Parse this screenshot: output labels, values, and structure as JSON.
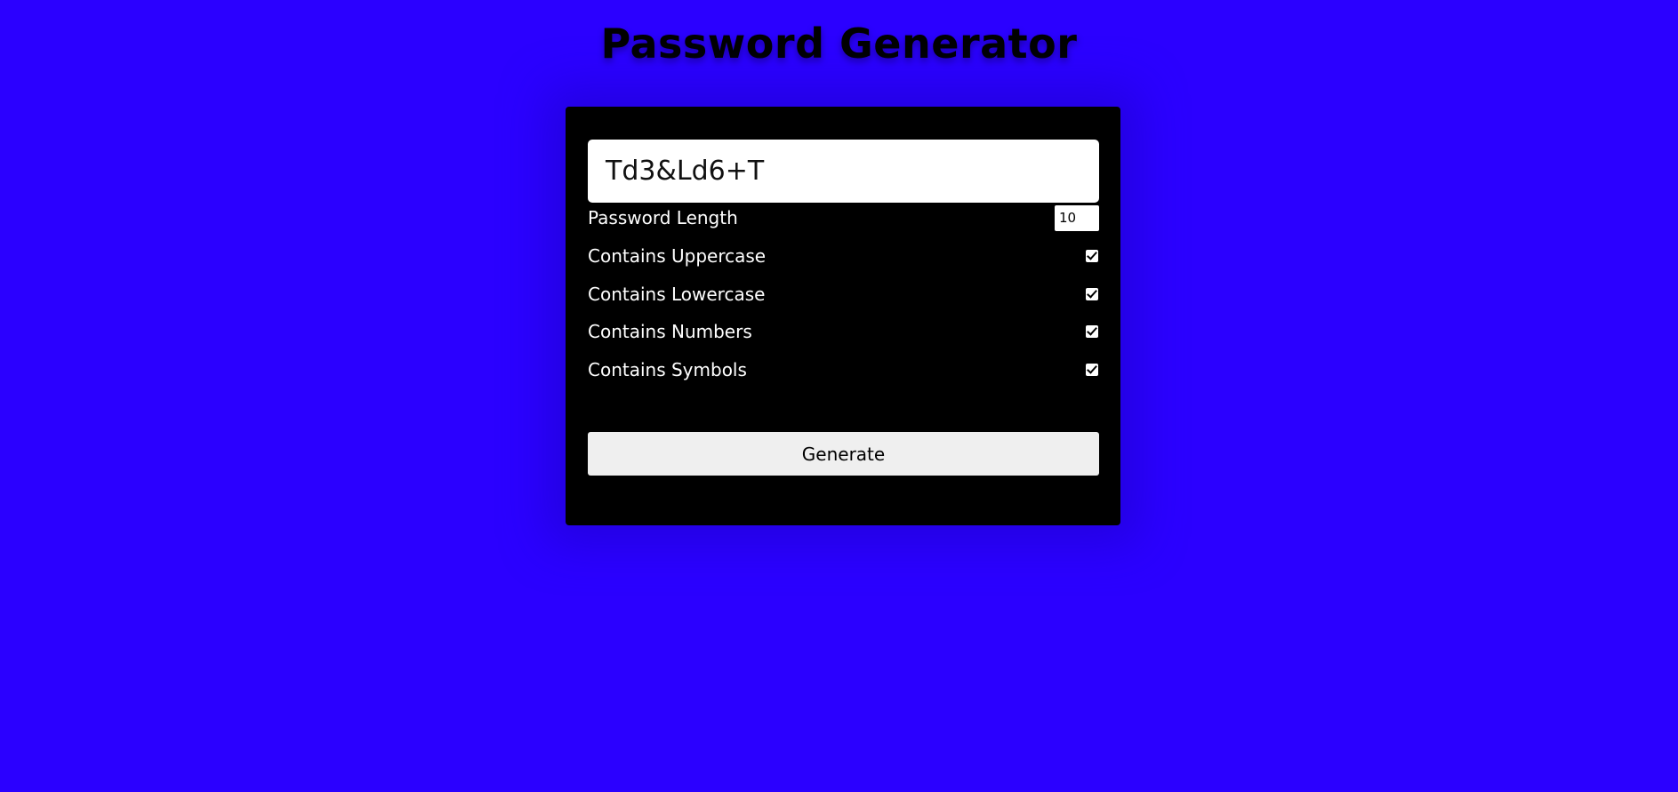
{
  "page": {
    "title": "Password Generator"
  },
  "result": {
    "value": "Td3&Ld6+T"
  },
  "settings": {
    "length_label": "Password Length",
    "length_value": "10",
    "options": [
      {
        "label": "Contains Uppercase",
        "checked": true
      },
      {
        "label": "Contains Lowercase",
        "checked": true
      },
      {
        "label": "Contains Numbers",
        "checked": true
      },
      {
        "label": "Contains Symbols",
        "checked": true
      }
    ]
  },
  "actions": {
    "generate_label": "Generate"
  },
  "colors": {
    "background": "#2b00ff",
    "card": "#000000",
    "text": "#ffffff"
  }
}
